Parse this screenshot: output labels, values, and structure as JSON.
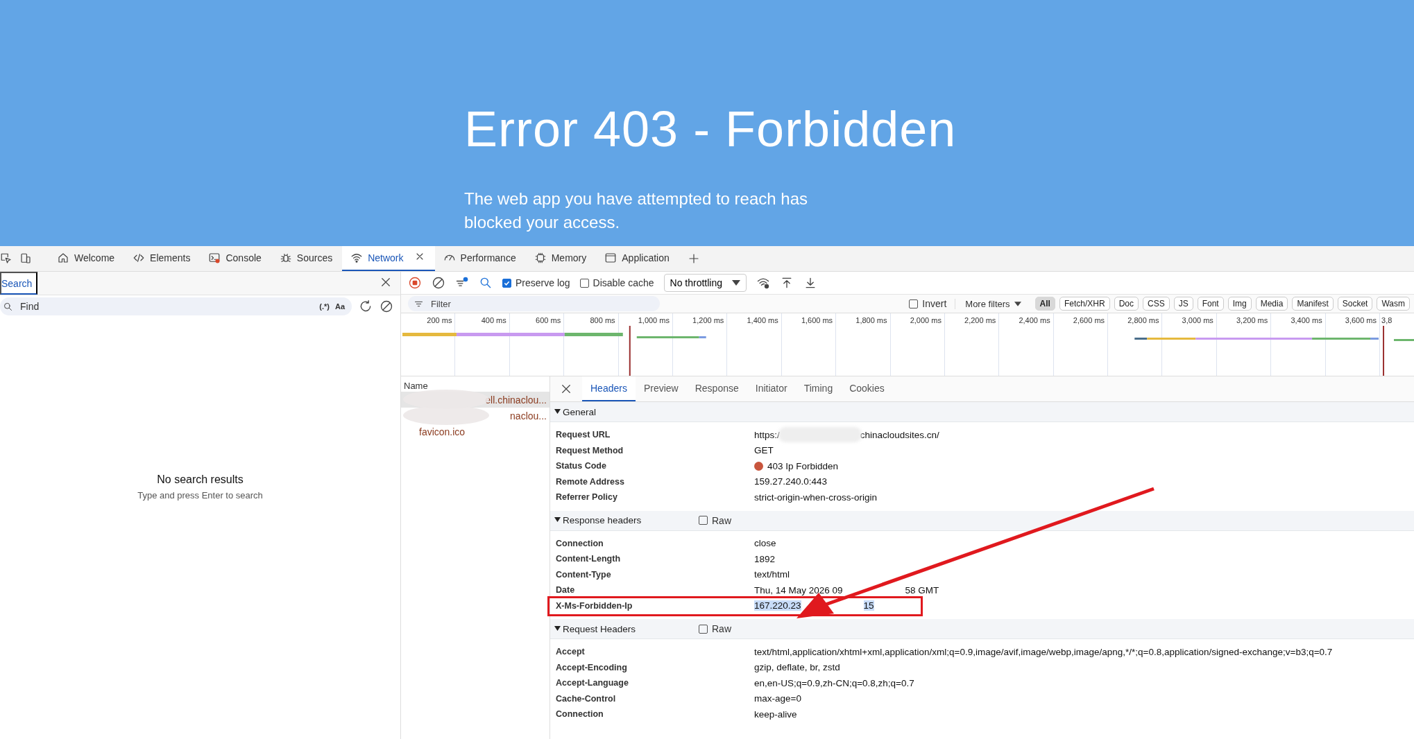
{
  "page": {
    "title": "Error 403 - Forbidden",
    "message": "The web app you have attempted to reach has blocked your access."
  },
  "tabs": [
    {
      "label": "Welcome",
      "selected": false
    },
    {
      "label": "Elements",
      "selected": false
    },
    {
      "label": "Console",
      "selected": false
    },
    {
      "label": "Sources",
      "selected": false
    },
    {
      "label": "Network",
      "selected": true
    },
    {
      "label": "Performance",
      "selected": false
    },
    {
      "label": "Memory",
      "selected": false
    },
    {
      "label": "Application",
      "selected": false
    }
  ],
  "search_panel": {
    "tab": "Search",
    "placeholder": "Find",
    "regex": "(.*)",
    "match_case": "Aa",
    "empty_title": "No search results",
    "empty_hint": "Type and press Enter to search"
  },
  "toolbar": {
    "recording": true,
    "preserve_log": {
      "label": "Preserve log",
      "checked": true
    },
    "disable_cache": {
      "label": "Disable cache",
      "checked": false
    },
    "throttling": "No throttling"
  },
  "filter": {
    "placeholder": "Filter",
    "invert": {
      "label": "Invert",
      "checked": false
    },
    "more_filters": "More filters",
    "types": [
      {
        "label": "All",
        "selected": true
      },
      {
        "label": "Fetch/XHR",
        "selected": false
      },
      {
        "label": "Doc",
        "selected": false
      },
      {
        "label": "CSS",
        "selected": false
      },
      {
        "label": "JS",
        "selected": false
      },
      {
        "label": "Font",
        "selected": false
      },
      {
        "label": "Img",
        "selected": false
      },
      {
        "label": "Media",
        "selected": false
      },
      {
        "label": "Manifest",
        "selected": false
      },
      {
        "label": "Socket",
        "selected": false
      },
      {
        "label": "Wasm",
        "selected": false
      }
    ]
  },
  "timeline": {
    "ticks": [
      "200 ms",
      "400 ms",
      "600 ms",
      "800 ms",
      "1,000 ms",
      "1,200 ms",
      "1,400 ms",
      "1,600 ms",
      "1,800 ms",
      "2,000 ms",
      "2,200 ms",
      "2,400 ms",
      "2,600 ms",
      "2,800 ms",
      "3,000 ms",
      "3,200 ms",
      "3,400 ms",
      "3,600 ms",
      "3,8"
    ]
  },
  "requests": {
    "column": "Name",
    "rows": [
      {
        "name": "ell.chinaclou...",
        "selected": true,
        "redacted": true
      },
      {
        "name": "naclou...",
        "selected": false,
        "redacted": true
      },
      {
        "name": "favicon.ico",
        "selected": false,
        "redacted": false
      }
    ]
  },
  "detail_tabs": [
    {
      "label": "Headers",
      "selected": true
    },
    {
      "label": "Preview",
      "selected": false
    },
    {
      "label": "Response",
      "selected": false
    },
    {
      "label": "Initiator",
      "selected": false
    },
    {
      "label": "Timing",
      "selected": false
    },
    {
      "label": "Cookies",
      "selected": false
    }
  ],
  "sections": [
    {
      "title": "General",
      "expanded": true,
      "rows": [
        {
          "key": "Request URL",
          "parts": [
            "https:/",
            "chinacloudsites.cn/"
          ],
          "redacted": true
        },
        {
          "key": "Request Method",
          "parts": [
            "GET"
          ]
        },
        {
          "key": "Status Code",
          "parts": [
            "403 Ip Forbidden"
          ],
          "color": "#c8553d"
        },
        {
          "key": "Remote Address",
          "parts": [
            "159.27.240.0:443"
          ]
        },
        {
          "key": "Referrer Policy",
          "parts": [
            "strict-origin-when-cross-origin"
          ]
        }
      ]
    },
    {
      "title": "Response headers",
      "expanded": true,
      "raw": {
        "label": "Raw",
        "checked": false
      },
      "rows": [
        {
          "key": "Connection",
          "parts": [
            "close"
          ]
        },
        {
          "key": "Content-Length",
          "parts": [
            "1892"
          ]
        },
        {
          "key": "Content-Type",
          "parts": [
            "text/html"
          ]
        },
        {
          "key": "Date",
          "parts": [
            "Thu, 14 May 2026 09",
            "58 GMT"
          ]
        },
        {
          "key": "X-Ms-Forbidden-Ip",
          "parts": [
            "167.220.23",
            "15"
          ],
          "highlighted": true,
          "text_selected": true
        }
      ]
    },
    {
      "title": "Request Headers",
      "expanded": true,
      "raw": {
        "label": "Raw",
        "checked": false
      },
      "rows": [
        {
          "key": "Accept",
          "parts": [
            "text/html,application/xhtml+xml,application/xml;q=0.9,image/avif,image/webp,image/apng,*/*;q=0.8,application/signed-exchange;v=b3;q=0.7"
          ]
        },
        {
          "key": "Accept-Encoding",
          "parts": [
            "gzip, deflate, br, zstd"
          ]
        },
        {
          "key": "Accept-Language",
          "parts": [
            "en,en-US;q=0.9,zh-CN;q=0.8,zh;q=0.7"
          ]
        },
        {
          "key": "Cache-Control",
          "parts": [
            "max-age=0"
          ]
        },
        {
          "key": "Connection",
          "parts": [
            "keep-alive"
          ]
        }
      ]
    }
  ]
}
